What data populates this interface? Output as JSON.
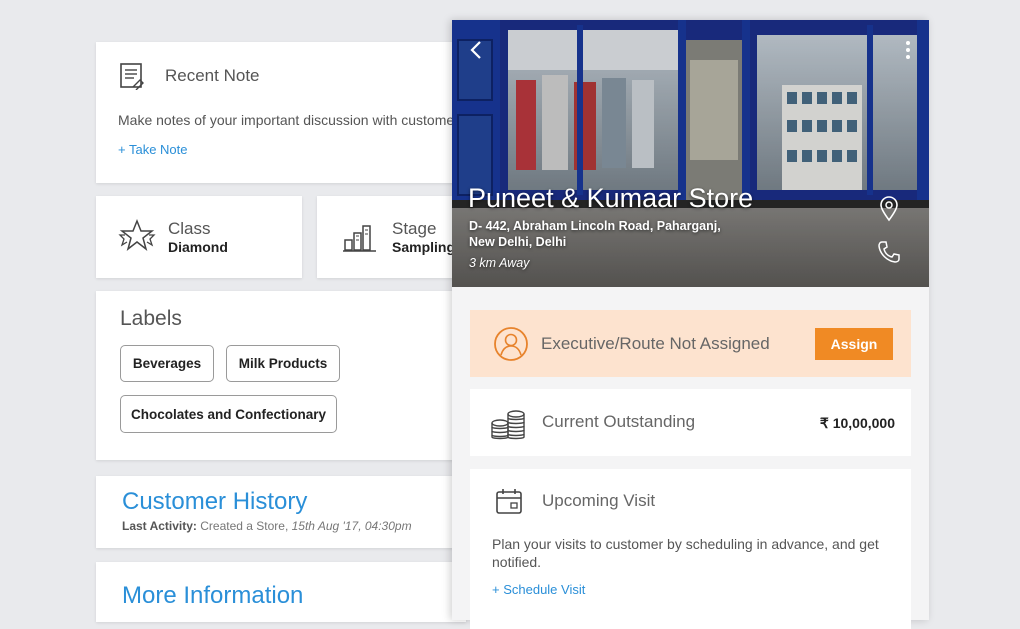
{
  "recent_note": {
    "title": "Recent Note",
    "description": "Make notes of your important discussion with customer",
    "action": "+  Take Note"
  },
  "class": {
    "title": "Class",
    "value": "Diamond"
  },
  "stage": {
    "title": "Stage",
    "value": "Sampling"
  },
  "labels": {
    "title": "Labels",
    "items": [
      "Beverages",
      "Milk Products",
      "Chocolates and Confectionary"
    ]
  },
  "customer_history": {
    "title": "Customer History",
    "last_activity_label": "Last Activity:",
    "last_activity_text": " Created a Store, ",
    "last_activity_time": "15th Aug '17, 04:30pm"
  },
  "more_information": {
    "title": "More Information"
  },
  "store": {
    "name": "Puneet & Kumaar Store",
    "address_line1": "D- 442, Abraham Lincoln Road, Paharganj,",
    "address_line2": "New Delhi, Delhi",
    "distance": "3 km Away"
  },
  "executive": {
    "text": "Executive/Route Not Assigned",
    "button": "Assign"
  },
  "outstanding": {
    "label": "Current Outstanding",
    "amount": "₹ 10,00,000"
  },
  "upcoming_visit": {
    "title": "Upcoming Visit",
    "description": "Plan your visits to customer by scheduling in advance, and get notified.",
    "action": "+ Schedule Visit"
  },
  "colors": {
    "accent_blue": "#2a8fd8",
    "orange": "#f08a24",
    "peach": "#fde3cf",
    "store_blue": "#1a3aa0"
  },
  "icons": [
    "note-icon",
    "star-icon",
    "bar-chart-icon",
    "back-arrow-icon",
    "more-vertical-icon",
    "location-pin-icon",
    "phone-icon",
    "user-circle-icon",
    "coins-icon",
    "calendar-icon"
  ]
}
